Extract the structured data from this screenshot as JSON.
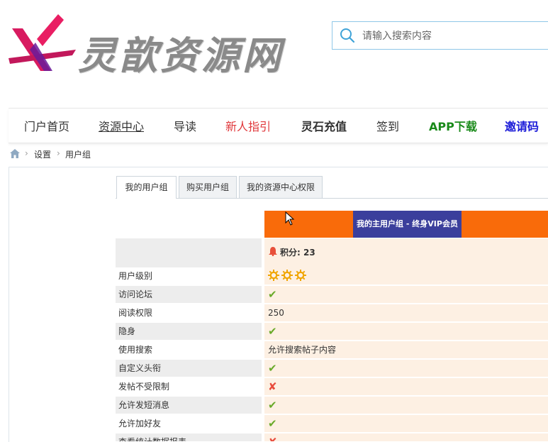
{
  "brand": {
    "name": "灵歆资源网"
  },
  "search": {
    "placeholder": "请输入搜索内容"
  },
  "nav": {
    "items": [
      "门户首页",
      "资源中心",
      "导读",
      "新人指引",
      "灵石充值",
      "签到",
      "APP下载",
      "邀请码"
    ]
  },
  "breadcrumb": {
    "items": [
      "设置",
      "用户组"
    ]
  },
  "tabs": [
    "我的用户组",
    "购买用户组",
    "我的资源中心权限"
  ],
  "group": {
    "title": "我的主用户组 - 终身VIP会员",
    "points": "积分: 23"
  },
  "rows": [
    {
      "label": "用户级别",
      "value": "",
      "icon": "sun-icon",
      "count": 3
    },
    {
      "label": "访问论坛",
      "value": "✔",
      "icon": "check-icon"
    },
    {
      "label": "阅读权限",
      "value": "250"
    },
    {
      "label": "隐身",
      "value": "✔",
      "icon": "check-icon"
    },
    {
      "label": "使用搜索",
      "value": "允许搜索帖子内容"
    },
    {
      "label": "自定义头衔",
      "value": "✔",
      "icon": "check-icon"
    },
    {
      "label": "发帖不受限制",
      "value": "✘",
      "icon": "cross-icon"
    },
    {
      "label": "允许发短消息",
      "value": "✔",
      "icon": "check-icon"
    },
    {
      "label": "允许加好友",
      "value": "✔",
      "icon": "check-icon"
    },
    {
      "label": "查看统计数据报表",
      "value": "✘",
      "icon": "cross-icon"
    }
  ],
  "colors": {
    "accent_orange": "#f96b0a",
    "group_title_bg": "#3b3f9c",
    "check": "#6aaa2a",
    "cross": "#e84c3d"
  }
}
